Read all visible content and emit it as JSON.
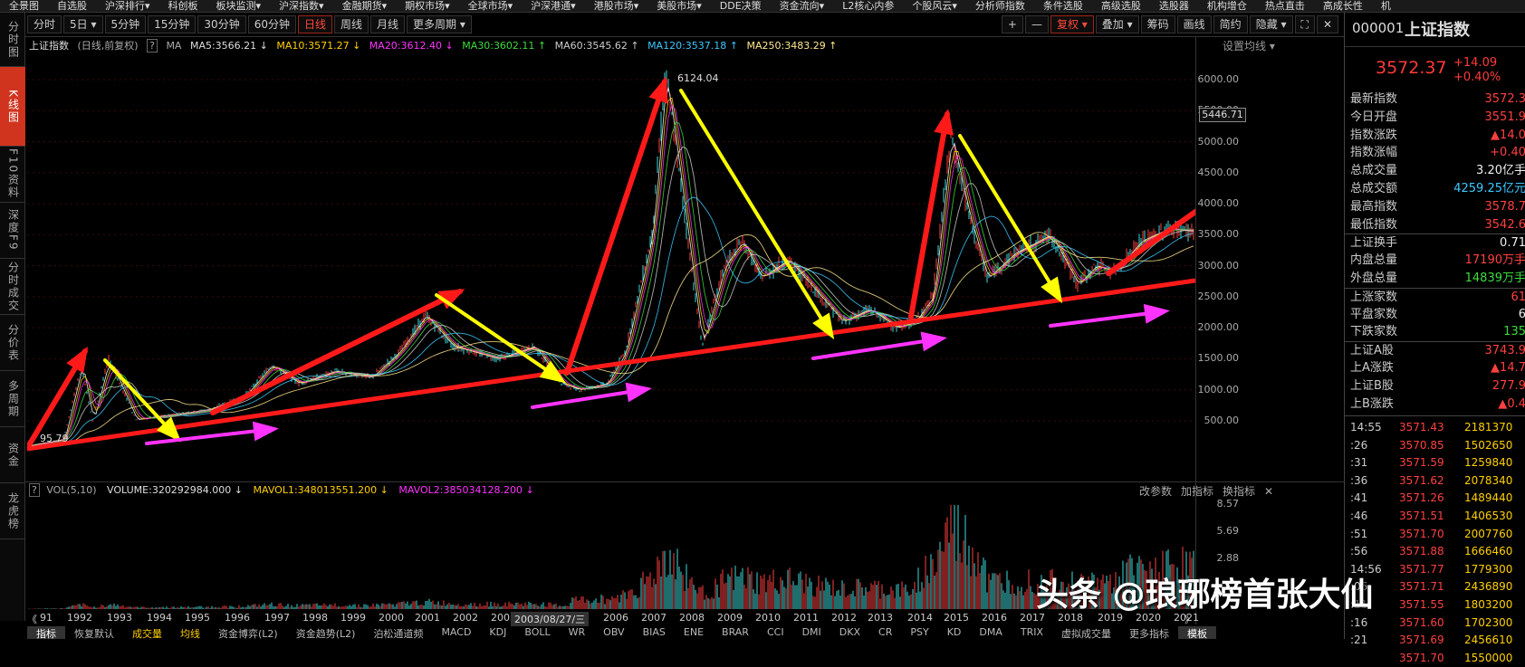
{
  "top_menu": [
    "全景图",
    "自选股",
    "沪深排行▾",
    "科创板",
    "板块监测▾",
    "沪深指数▾",
    "金融期货▾",
    "期权市场▾",
    "全球市场▾",
    "沪深港通▾",
    "港股市场▾",
    "美股市场▾",
    "DDE决策",
    "资金流向▾",
    "L2核心内参",
    "个股风云▾",
    "分析师指数",
    "条件选股",
    "高级选股",
    "选股器",
    "机构增仓",
    "热点直击",
    "高成长性",
    "机"
  ],
  "toolbar": {
    "periods": [
      "分时",
      "5日 ▾",
      "5分钟",
      "15分钟",
      "30分钟",
      "60分钟",
      "日线",
      "周线",
      "月线",
      "更多周期 ▾"
    ],
    "active": "日线",
    "right": [
      "+",
      "—",
      "复权 ▾",
      "叠加 ▾",
      "筹码",
      "画线",
      "简约",
      "隐藏 ▾",
      "⛶",
      "✕"
    ]
  },
  "left_tabs": [
    "分时图",
    "K线图",
    "F10资料",
    "深度F9",
    "分时成交",
    "分价表",
    "多周期",
    "资金",
    "龙虎榜"
  ],
  "legend": {
    "name": "上证指数",
    "mode": "(日线,前复权)",
    "q": "?",
    "ma": "MA",
    "ma5": "MA5:3566.21 ↓",
    "ma10": "MA10:3571.27 ↓",
    "ma20": "MA20:3612.40 ↓",
    "ma30": "MA30:3602.11 ↑",
    "ma60": "MA60:3545.62 ↑",
    "ma120": "MA120:3537.18 ↑",
    "ma250": "MA250:3483.29 ↑",
    "set": "设置均线 ▾"
  },
  "price_axis": [
    "6000.00",
    "5500.00",
    "5000.00",
    "4500.00",
    "4000.00",
    "3500.00",
    "3000.00",
    "2500.00",
    "2000.00",
    "1500.00",
    "1000.00",
    "500.00"
  ],
  "current_price_box": "5446.71",
  "annotations": {
    "high": "6124.04",
    "low": "95.79"
  },
  "vol_legend": {
    "q": "?",
    "name": "VOL(5,10)",
    "volume": "VOLUME:320292984.000 ↓",
    "mavol1": "MAVOL1:348013551.200 ↓",
    "mavol2": "MAVOL2:385034128.200 ↓"
  },
  "vol_buttons": [
    "改参数",
    "加指标",
    "换指标",
    "✕"
  ],
  "vol_axis": [
    "8.57",
    "5.69",
    "2.88"
  ],
  "time_axis": {
    "start": "《",
    "years": [
      "91",
      "1992",
      "1993",
      "1994",
      "1995",
      "1996",
      "1997",
      "1998",
      "1999",
      "2000",
      "2001",
      "2002",
      "2003",
      "2006",
      "2007",
      "2008",
      "2009",
      "2010",
      "2011",
      "2012",
      "2013",
      "2014",
      "2015",
      "2016",
      "2017",
      "2018",
      "2019",
      "2020",
      "2021"
    ],
    "cursor": "2003/08/27/三",
    "end": "》"
  },
  "bottom_tabs": [
    "指标",
    "恢复默认",
    "成交量",
    "均线",
    "资金博弈(L2)",
    "资金趋势(L2)",
    "泊松通道频",
    "MACD",
    "KDJ",
    "BOLL",
    "WR",
    "OBV",
    "BIAS",
    "ENE",
    "BRAR",
    "CCI",
    "DMI",
    "DKX",
    "CR",
    "PSY",
    "KD",
    "DMA",
    "TRIX",
    "虚拟成交量",
    "更多指标",
    "模板"
  ],
  "sidebar": {
    "code": "000001",
    "name": "上证指数",
    "price": "3572.37",
    "change": "+14.09",
    "change_pct": "+0.40%",
    "rows1": [
      [
        "最新指数",
        "3572.3"
      ],
      [
        "今日开盘",
        "3551.9"
      ],
      [
        "指数涨跌",
        "▲14.0"
      ],
      [
        "指数涨幅",
        "+0.40"
      ],
      [
        "总成交量",
        "3.20亿手"
      ],
      [
        "总成交额",
        "4259.25亿元"
      ],
      [
        "最高指数",
        "3578.7"
      ],
      [
        "最低指数",
        "3542.6"
      ]
    ],
    "rows2": [
      [
        "上证换手",
        "0.71"
      ],
      [
        "内盘总量",
        "17190万手"
      ],
      [
        "外盘总量",
        "14839万手"
      ]
    ],
    "rows3": [
      [
        "上涨家数",
        "61"
      ],
      [
        "平盘家数",
        "6"
      ],
      [
        "下跌家数",
        "135"
      ]
    ],
    "rows4": [
      [
        "上证A股",
        "3743.9"
      ],
      [
        "上A涨跌",
        "▲14.7"
      ],
      [
        "上证B股",
        "277.9"
      ],
      [
        "上B涨跌",
        "▲0.4"
      ]
    ],
    "ticks": [
      [
        "14:55",
        "3571.43",
        "2181370"
      ],
      [
        ":26",
        "3570.85",
        "1502650"
      ],
      [
        ":31",
        "3571.59",
        "1259840"
      ],
      [
        ":36",
        "3571.62",
        "2078340"
      ],
      [
        ":41",
        "3571.26",
        "1489440"
      ],
      [
        ":46",
        "3571.51",
        "1406530"
      ],
      [
        ":51",
        "3571.70",
        "2007760"
      ],
      [
        ":56",
        "3571.88",
        "1666460"
      ],
      [
        "14:56",
        "3571.77",
        "1779300"
      ],
      [
        ":06",
        "3571.71",
        "2436890"
      ],
      [
        ":11",
        "3571.55",
        "1803200"
      ],
      [
        ":16",
        "3571.60",
        "1702300"
      ],
      [
        ":21",
        "3571.69",
        "2456610"
      ],
      [
        "",
        "3571.70",
        "1550000"
      ]
    ]
  },
  "watermark": "头条 @琅琊榜首张大仙",
  "colors": {
    "up": "#ff3a3a",
    "down": "#3cdc3c",
    "accent": "#d0341f",
    "trend_red": "#ff1a1a",
    "trend_yellow": "#ffff00",
    "trend_magenta": "#ff33ff"
  }
}
